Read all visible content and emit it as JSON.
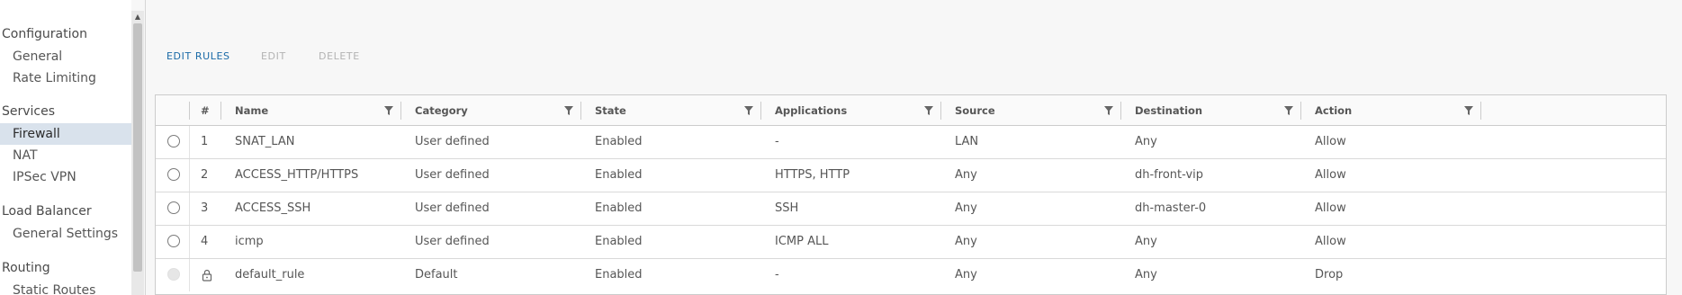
{
  "sidebar": {
    "sections": [
      {
        "title": "Configuration",
        "items": [
          {
            "label": "General",
            "active": false
          },
          {
            "label": "Rate Limiting",
            "active": false
          }
        ]
      },
      {
        "title": "Services",
        "items": [
          {
            "label": "Firewall",
            "active": true
          },
          {
            "label": "NAT",
            "active": false
          },
          {
            "label": "IPSec VPN",
            "active": false
          }
        ]
      },
      {
        "title": "Load Balancer",
        "items": [
          {
            "label": "General Settings",
            "active": false
          }
        ]
      },
      {
        "title": "Routing",
        "items": [
          {
            "label": "Static Routes",
            "active": false
          }
        ]
      }
    ]
  },
  "toolbar": {
    "edit_rules": "EDIT RULES",
    "edit": "EDIT",
    "delete": "DELETE"
  },
  "grid": {
    "columns": [
      "#",
      "Name",
      "Category",
      "State",
      "Applications",
      "Source",
      "Destination",
      "Action"
    ],
    "rows": [
      {
        "num": "1",
        "name": "SNAT_LAN",
        "category": "User defined",
        "state": "Enabled",
        "applications": "-",
        "source": "LAN",
        "destination": "Any",
        "action": "Allow",
        "locked": false
      },
      {
        "num": "2",
        "name": "ACCESS_HTTP/HTTPS",
        "category": "User defined",
        "state": "Enabled",
        "applications": "HTTPS, HTTP",
        "source": "Any",
        "destination": "dh-front-vip",
        "action": "Allow",
        "locked": false
      },
      {
        "num": "3",
        "name": "ACCESS_SSH",
        "category": "User defined",
        "state": "Enabled",
        "applications": "SSH",
        "source": "Any",
        "destination": "dh-master-0",
        "action": "Allow",
        "locked": false
      },
      {
        "num": "4",
        "name": "icmp",
        "category": "User defined",
        "state": "Enabled",
        "applications": "ICMP ALL",
        "source": "Any",
        "destination": "Any",
        "action": "Allow",
        "locked": false
      },
      {
        "num": "",
        "name": "default_rule",
        "category": "Default",
        "state": "Enabled",
        "applications": "-",
        "source": "Any",
        "destination": "Any",
        "action": "Drop",
        "locked": true
      }
    ]
  },
  "colors": {
    "link": "#1a6aa7",
    "disabled": "#b3b3b3",
    "active_nav": "#d9e2ec"
  }
}
